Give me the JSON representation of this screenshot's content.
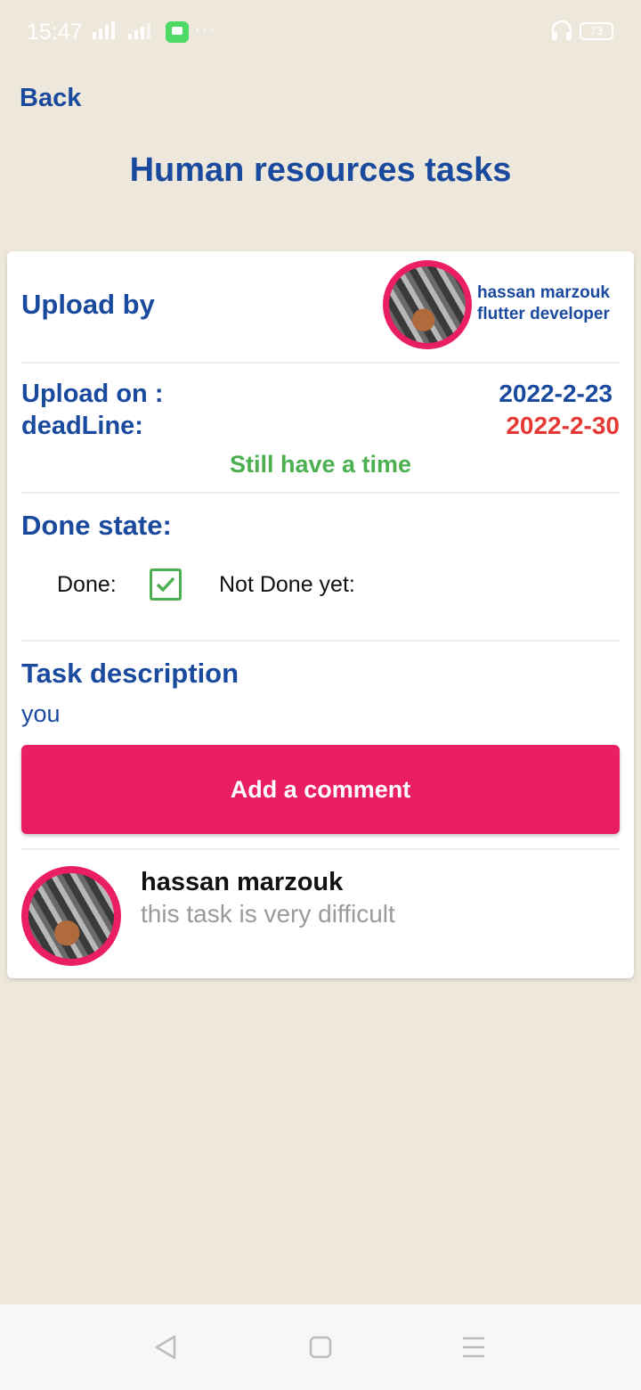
{
  "status_bar": {
    "time": "15:47",
    "battery": "73",
    "icons": [
      "signal-icon",
      "chat-icon",
      "headset-icon",
      "battery-icon"
    ]
  },
  "header": {
    "back_label": "Back",
    "title": "Human resources tasks"
  },
  "task": {
    "upload_by_label": "Upload by",
    "uploader": {
      "name": "hassan marzouk",
      "role": "flutter developer"
    },
    "upload_on_label": "Upload on :",
    "upload_on_value": "2022-2-23",
    "deadline_label": "deadLine:",
    "deadline_value": "2022-2-30",
    "time_status": "Still have a time",
    "done_state_label": "Done state:",
    "done_label": "Done:",
    "done_checked": true,
    "not_done_label": "Not Done yet:",
    "description_label": "Task description",
    "description": "you",
    "add_comment_label": "Add a comment"
  },
  "comments": [
    {
      "author": "hassan marzouk",
      "text": "this task is very difficult"
    }
  ],
  "colors": {
    "background": "#EDE7DC",
    "primary": "#1A4A9E",
    "accent": "#E91E63",
    "deadline": "#E53935",
    "success": "#4CAF50"
  },
  "navigation": [
    "back-triangle-icon",
    "home-square-icon",
    "menu-lines-icon"
  ]
}
